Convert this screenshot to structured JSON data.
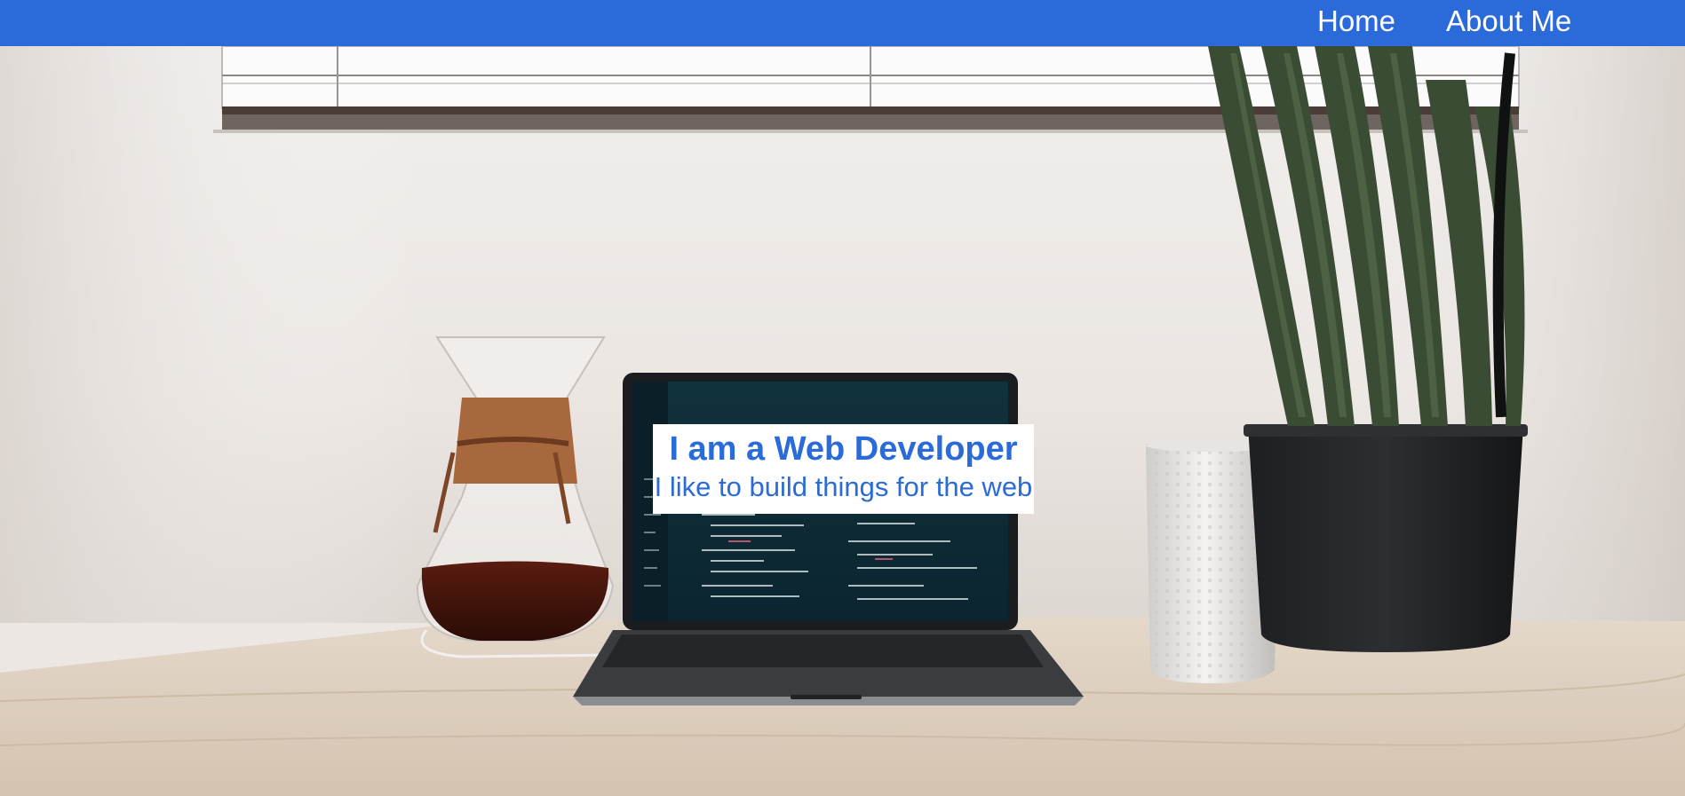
{
  "nav": {
    "items": [
      {
        "label": "Home"
      },
      {
        "label": "About Me"
      }
    ]
  },
  "hero": {
    "title": "I am a Web Developer",
    "subtitle": "I like to build things for the web",
    "background_description_icon": "desk-photo"
  },
  "colors": {
    "accent": "#2a6ad9",
    "nav_text": "#ffffff",
    "intro_bg": "#ffffff"
  }
}
